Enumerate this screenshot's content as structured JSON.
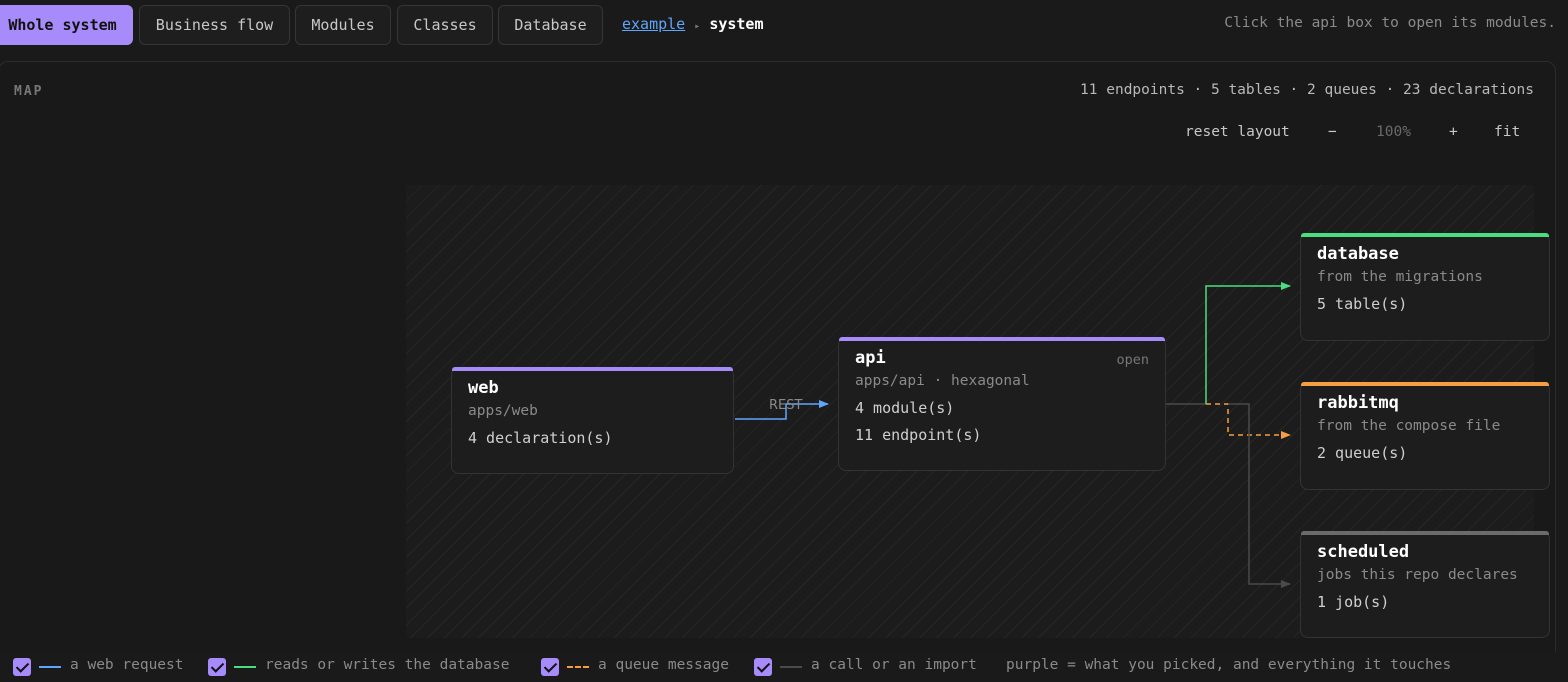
{
  "tabs": [
    {
      "label": "Whole system",
      "active": true
    },
    {
      "label": "Business flow",
      "active": false
    },
    {
      "label": "Modules",
      "active": false
    },
    {
      "label": "Classes",
      "active": false
    },
    {
      "label": "Database",
      "active": false
    }
  ],
  "breadcrumb": {
    "project": "example",
    "separator": "▸",
    "current": "system"
  },
  "hint": "Click the api box to open its modules.",
  "map": {
    "label": "MAP",
    "stats": "11 endpoints · 5 tables · 2 queues · 23 declarations",
    "controls": {
      "reset": "reset layout",
      "zoom_out": "−",
      "zoom": "100%",
      "zoom_in": "+",
      "fit": "fit"
    }
  },
  "nodes": {
    "web": {
      "title": "web",
      "sub": "apps/web",
      "line1": "4 declaration(s)",
      "accent": "#a78bfa"
    },
    "api": {
      "title": "api",
      "sub": "apps/api · hexagonal",
      "line1": "4 module(s)",
      "line2": "11 endpoint(s)",
      "action": "open",
      "accent": "#a78bfa"
    },
    "database": {
      "title": "database",
      "sub": "from the migrations",
      "line1": "5 table(s)",
      "accent": "#4ade80"
    },
    "rabbitmq": {
      "title": "rabbitmq",
      "sub": "from the compose file",
      "line1": "2 queue(s)",
      "accent": "#f59e42"
    },
    "scheduled": {
      "title": "scheduled",
      "sub": "jobs this repo declares",
      "line1": "1 job(s)",
      "accent": "#6b6b6b"
    }
  },
  "edges": {
    "rest_label": "REST"
  },
  "legend": {
    "items": [
      {
        "label": "a web request",
        "color": "#60a5fa",
        "style": "solid",
        "checked": true
      },
      {
        "label": "reads or writes the database",
        "color": "#4ade80",
        "style": "solid",
        "checked": true
      },
      {
        "label": "a queue message",
        "color": "#f59e42",
        "style": "dashed",
        "checked": true
      },
      {
        "label": "a call or an import",
        "color": "#4a4a4a",
        "style": "solid",
        "checked": true
      }
    ],
    "note": "purple = what you picked, and everything it touches"
  }
}
